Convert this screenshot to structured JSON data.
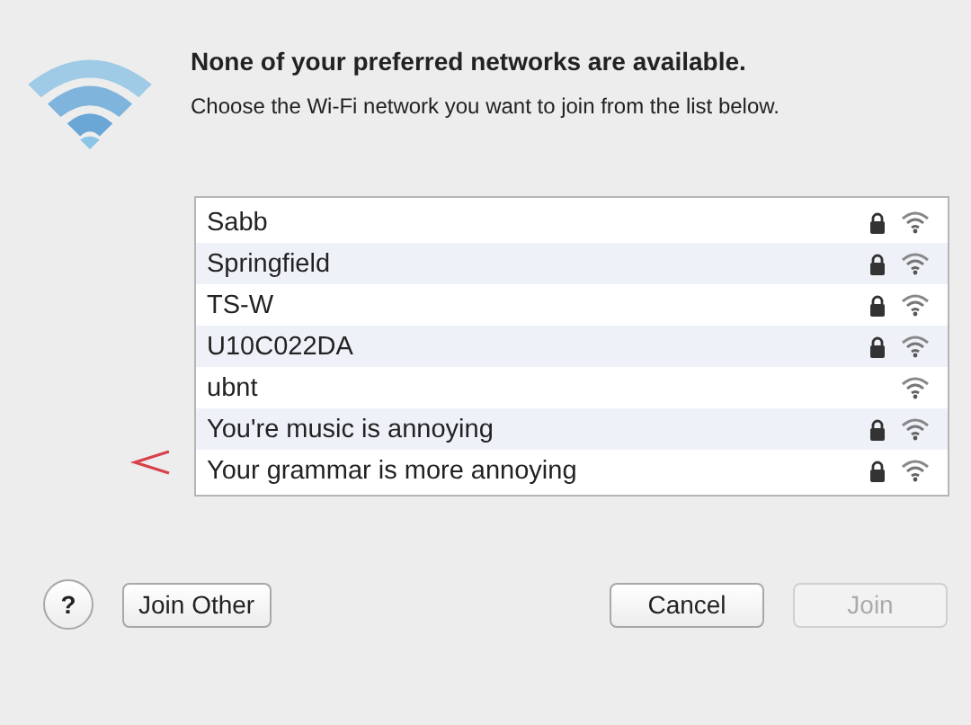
{
  "dialog": {
    "title": "None of your preferred networks are available.",
    "message": "Choose the Wi-Fi network you want to join from the list below."
  },
  "networks": [
    {
      "name": "Sabb",
      "secured": true
    },
    {
      "name": "Springfield",
      "secured": true
    },
    {
      "name": "TS-W",
      "secured": true
    },
    {
      "name": "U10C022DA",
      "secured": true
    },
    {
      "name": "ubnt",
      "secured": false
    },
    {
      "name": "You're music is annoying",
      "secured": true
    },
    {
      "name": "Your grammar is more annoying",
      "secured": true
    }
  ],
  "buttons": [
    {
      "label": "?",
      "kind": "help",
      "disabled": false
    },
    {
      "label": "Join Other",
      "kind": "left",
      "disabled": false
    },
    {
      "label": "Cancel",
      "kind": "right",
      "disabled": false
    },
    {
      "label": "Join",
      "kind": "right",
      "disabled": true
    }
  ]
}
